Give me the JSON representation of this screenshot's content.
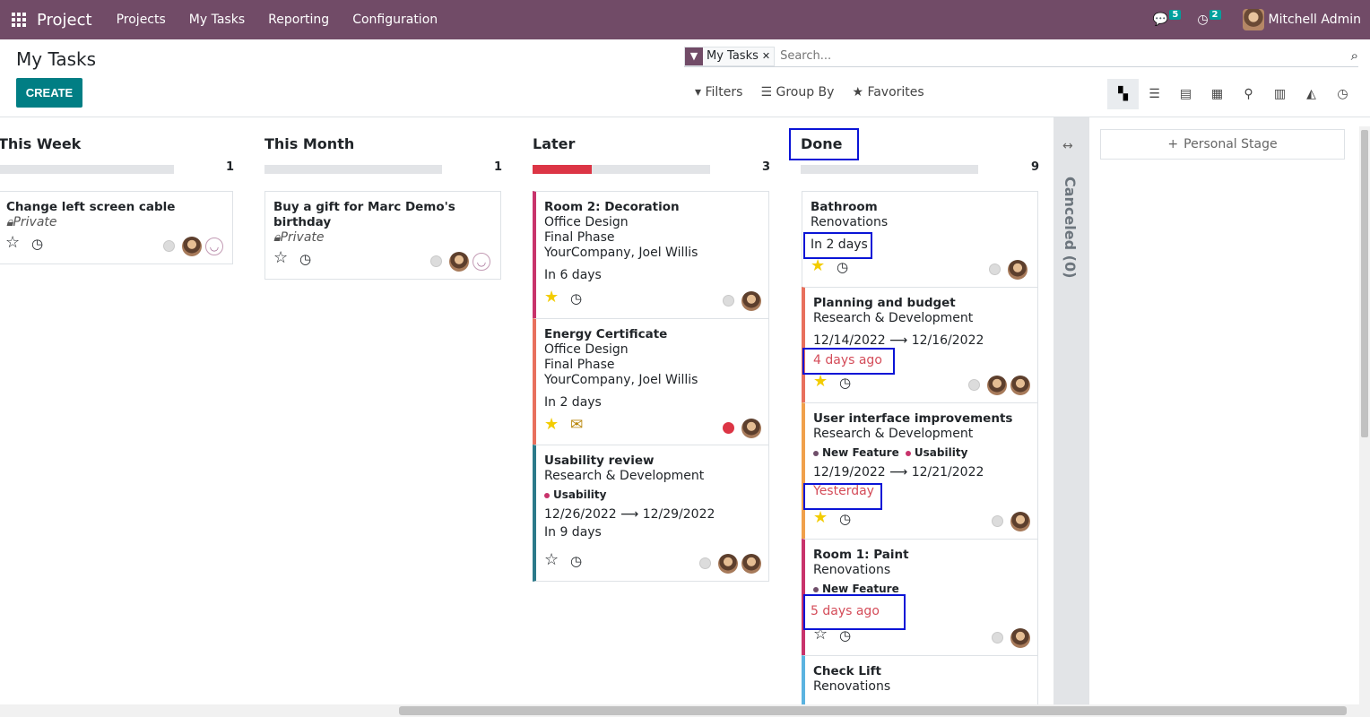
{
  "app": {
    "name": "Project",
    "menu": [
      "Projects",
      "My Tasks",
      "Reporting",
      "Configuration"
    ],
    "messages_count": "5",
    "activities_count": "2",
    "user": "Mitchell Admin"
  },
  "control": {
    "title": "My Tasks",
    "create": "CREATE",
    "facet": "My Tasks",
    "search_placeholder": "Search...",
    "filters": "Filters",
    "group_by": "Group By",
    "favorites": "Favorites"
  },
  "views": [
    "kanban",
    "list",
    "gantt",
    "calendar",
    "map",
    "pivot",
    "graph",
    "activity"
  ],
  "columns": [
    {
      "name": "This Week",
      "count": "1"
    },
    {
      "name": "This Month",
      "count": "1"
    },
    {
      "name": "Later",
      "count": "3"
    },
    {
      "name": "Done",
      "count": "9"
    }
  ],
  "cards": {
    "c1": {
      "title": "Change left screen cable",
      "private": "Private"
    },
    "c2": {
      "title1": "Buy a gift for Marc Demo's",
      "title2": "birthday",
      "private": "Private"
    },
    "l1": {
      "title": "Room 2: Decoration",
      "l1": "Office Design",
      "l2": "Final Phase",
      "l3": "YourCompany, Joel Willis",
      "due": "In 6 days"
    },
    "l2": {
      "title": "Energy Certificate",
      "l1": "Office Design",
      "l2": "Final Phase",
      "l3": "YourCompany, Joel Willis",
      "due": "In 2 days"
    },
    "l3": {
      "title": "Usability review",
      "l1": "Research & Development",
      "tag": "Usability",
      "dates": "12/26/2022",
      "dates2": "12/29/2022",
      "due": "In 9 days"
    },
    "d1": {
      "title": "Bathroom",
      "l1": "Renovations",
      "due": "In 2 days"
    },
    "d2": {
      "title": "Planning and budget",
      "l1": "Research & Development",
      "dates": "12/14/2022",
      "dates2": "12/16/2022",
      "due": "4 days ago"
    },
    "d3": {
      "title": "User interface improvements",
      "l1": "Research & Development",
      "tag1": "New Feature",
      "tag2": "Usability",
      "dates": "12/19/2022",
      "dates2": "12/21/2022",
      "due": "Yesterday"
    },
    "d4": {
      "title": "Room 1: Paint",
      "l1": "Renovations",
      "tag1": "New Feature",
      "due": "5 days ago"
    },
    "d5": {
      "title": "Check Lift",
      "l1": "Renovations"
    }
  },
  "folded": {
    "label": "Canceled (0)"
  },
  "personal_stage": "Personal Stage",
  "colors": {
    "brand": "#714b67",
    "primary": "#017e84",
    "highlight": "#0a14d6",
    "overdue": "#d44c59"
  }
}
